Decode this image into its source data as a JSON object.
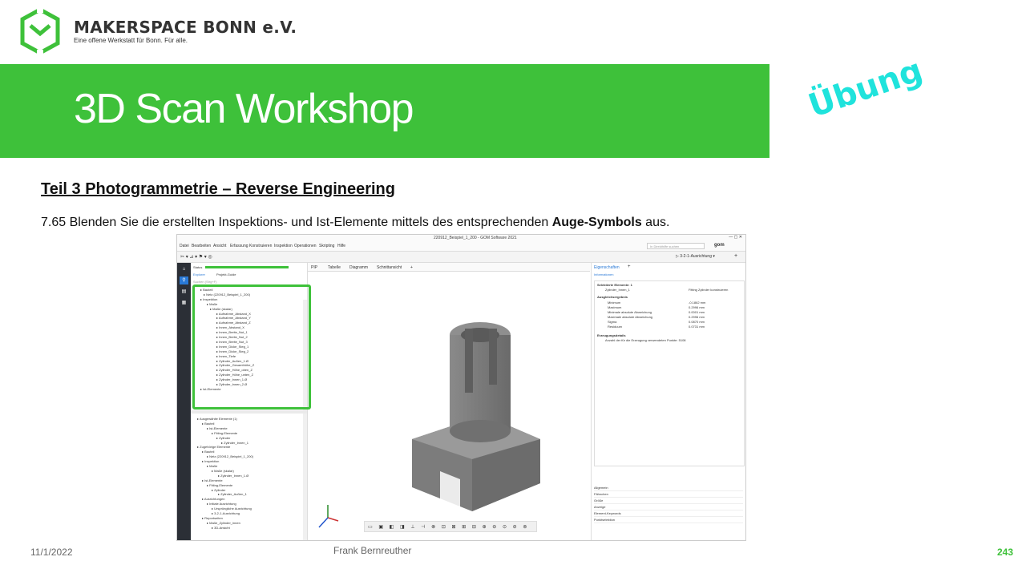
{
  "header": {
    "org_name": "MAKERSPACE BONN e.V.",
    "tagline": "Eine offene Werkstatt für Bonn. Für alle.",
    "title": "3D Scan Workshop",
    "badge": "Übung",
    "brand_color": "#3ec13a",
    "badge_color": "#1fe3dc"
  },
  "content": {
    "subtitle": "Teil 3  Photogrammetrie  – Reverse Engineering",
    "instruction_prefix": "7.65 Blenden Sie die erstellten Inspektions- und Ist-Elemente mittels des entsprechenden ",
    "instruction_bold": "Auge-Symbols",
    "instruction_suffix": " aus."
  },
  "footer": {
    "date": "11/1/2022",
    "author": "Frank Bernreuther",
    "page": "243"
  },
  "app": {
    "window_title": "220912_Beispiel_1_200 - GOM Software 2021",
    "menu": [
      "Datei",
      "Bearbeiten",
      "Ansicht",
      "Erfassung",
      "Konstruieren",
      "Inspektion",
      "Operationen",
      "Skripting",
      "Hilfe"
    ],
    "search_placeholder": "In Direkthilfe suchen",
    "alignment": "3-2-1-Ausrichtung",
    "left_tabs": [
      "Explorer",
      "Projekt-Guide"
    ],
    "status_label": "Status",
    "filter_placeholder": "Suchen (Strg+F)",
    "tree_top": [
      "Bauteil",
      "Netz (220912_Beispiel_1_200)",
      "Inspektion",
      "Maße",
      "Maße (skalar)",
      "Aufnahme_Abstand_X",
      "Aufnahme_Abstand_Y",
      "Aufnahme_Abstand_Z",
      "Innen_Abstand_X",
      "Innen_Breite_Nut_1",
      "Innen_Breite_Nut_2",
      "Innen_Breite_Nut_3",
      "Innen_Dicke_Steg_1",
      "Innen_Dicke_Steg_2",
      "Innen_Tiefe",
      "Zylinder_Außen_1.Ø",
      "Zylinder_Gesamthöhe_Z",
      "Zylinder_Höhe_oben_Z",
      "Zylinder_Höhe_unten_Z",
      "Zylinder_Innen_1.Ø",
      "Zylinder_Innen_2.Ø",
      "Ist-Elemente"
    ],
    "tree_bottom": [
      "Ausgewählte Elemente (1)",
      "Bauteil",
      "Ist-Elemente",
      "Fitting-Elemente",
      "Zylinder",
      "Zylinder_Innen_1",
      "Zugehörige Elemente",
      "Bauteil",
      "Netz (220912_Beispiel_1_200)",
      "Inspektion",
      "Maße",
      "Maße (skalar)",
      "Zylinder_Innen_1.Ø",
      "Ist-Elemente",
      "Fitting-Elemente",
      "Zylinder",
      "Zylinder_Außen_1",
      "Ausrichtungen",
      "Initiale Ausrichtung",
      "Ursprüngliche Ausrichtung",
      "3-2-1-Ausrichtung",
      "Reportseiten",
      "Maße_Zylinder_innen",
      "3D-Ansicht"
    ],
    "viewport_tabs": [
      "PIP",
      "Tabelle",
      "Diagramm",
      "Schnittansicht",
      "+"
    ],
    "props_tabs": [
      "Eigenschaften",
      "+"
    ],
    "props_sub": "Informationen",
    "props_selected_header": "Selektierte Elemente: 1",
    "props_selected_name": "Zylinder_Innen_1",
    "props_selected_value": "Fitting Zylinder konstruieren",
    "props_result_header": "Ausgleichsergebnis",
    "props_rows": [
      {
        "label": "Minimum",
        "value": "-0.1862 mm"
      },
      {
        "label": "Maximum",
        "value": "0.2996 mm"
      },
      {
        "label": "Minimale absolute Abweichung",
        "value": "0.0001 mm"
      },
      {
        "label": "Maximale absolute Abweichung",
        "value": "0.2996 mm"
      },
      {
        "label": "Sigma",
        "value": "0.0870 mm"
      },
      {
        "label": "Residuum",
        "value": "0.0731 mm"
      }
    ],
    "props_gen_header": "Erzeugungsdetails",
    "props_gen_row": "Anzahl der für die Erzeugung verwendeten Punkte:  5108",
    "props_sections": [
      "Allgemein",
      "Fähnchen",
      "Größe",
      "Anzeige",
      "Element-Keywords",
      "Punktselektion"
    ]
  }
}
